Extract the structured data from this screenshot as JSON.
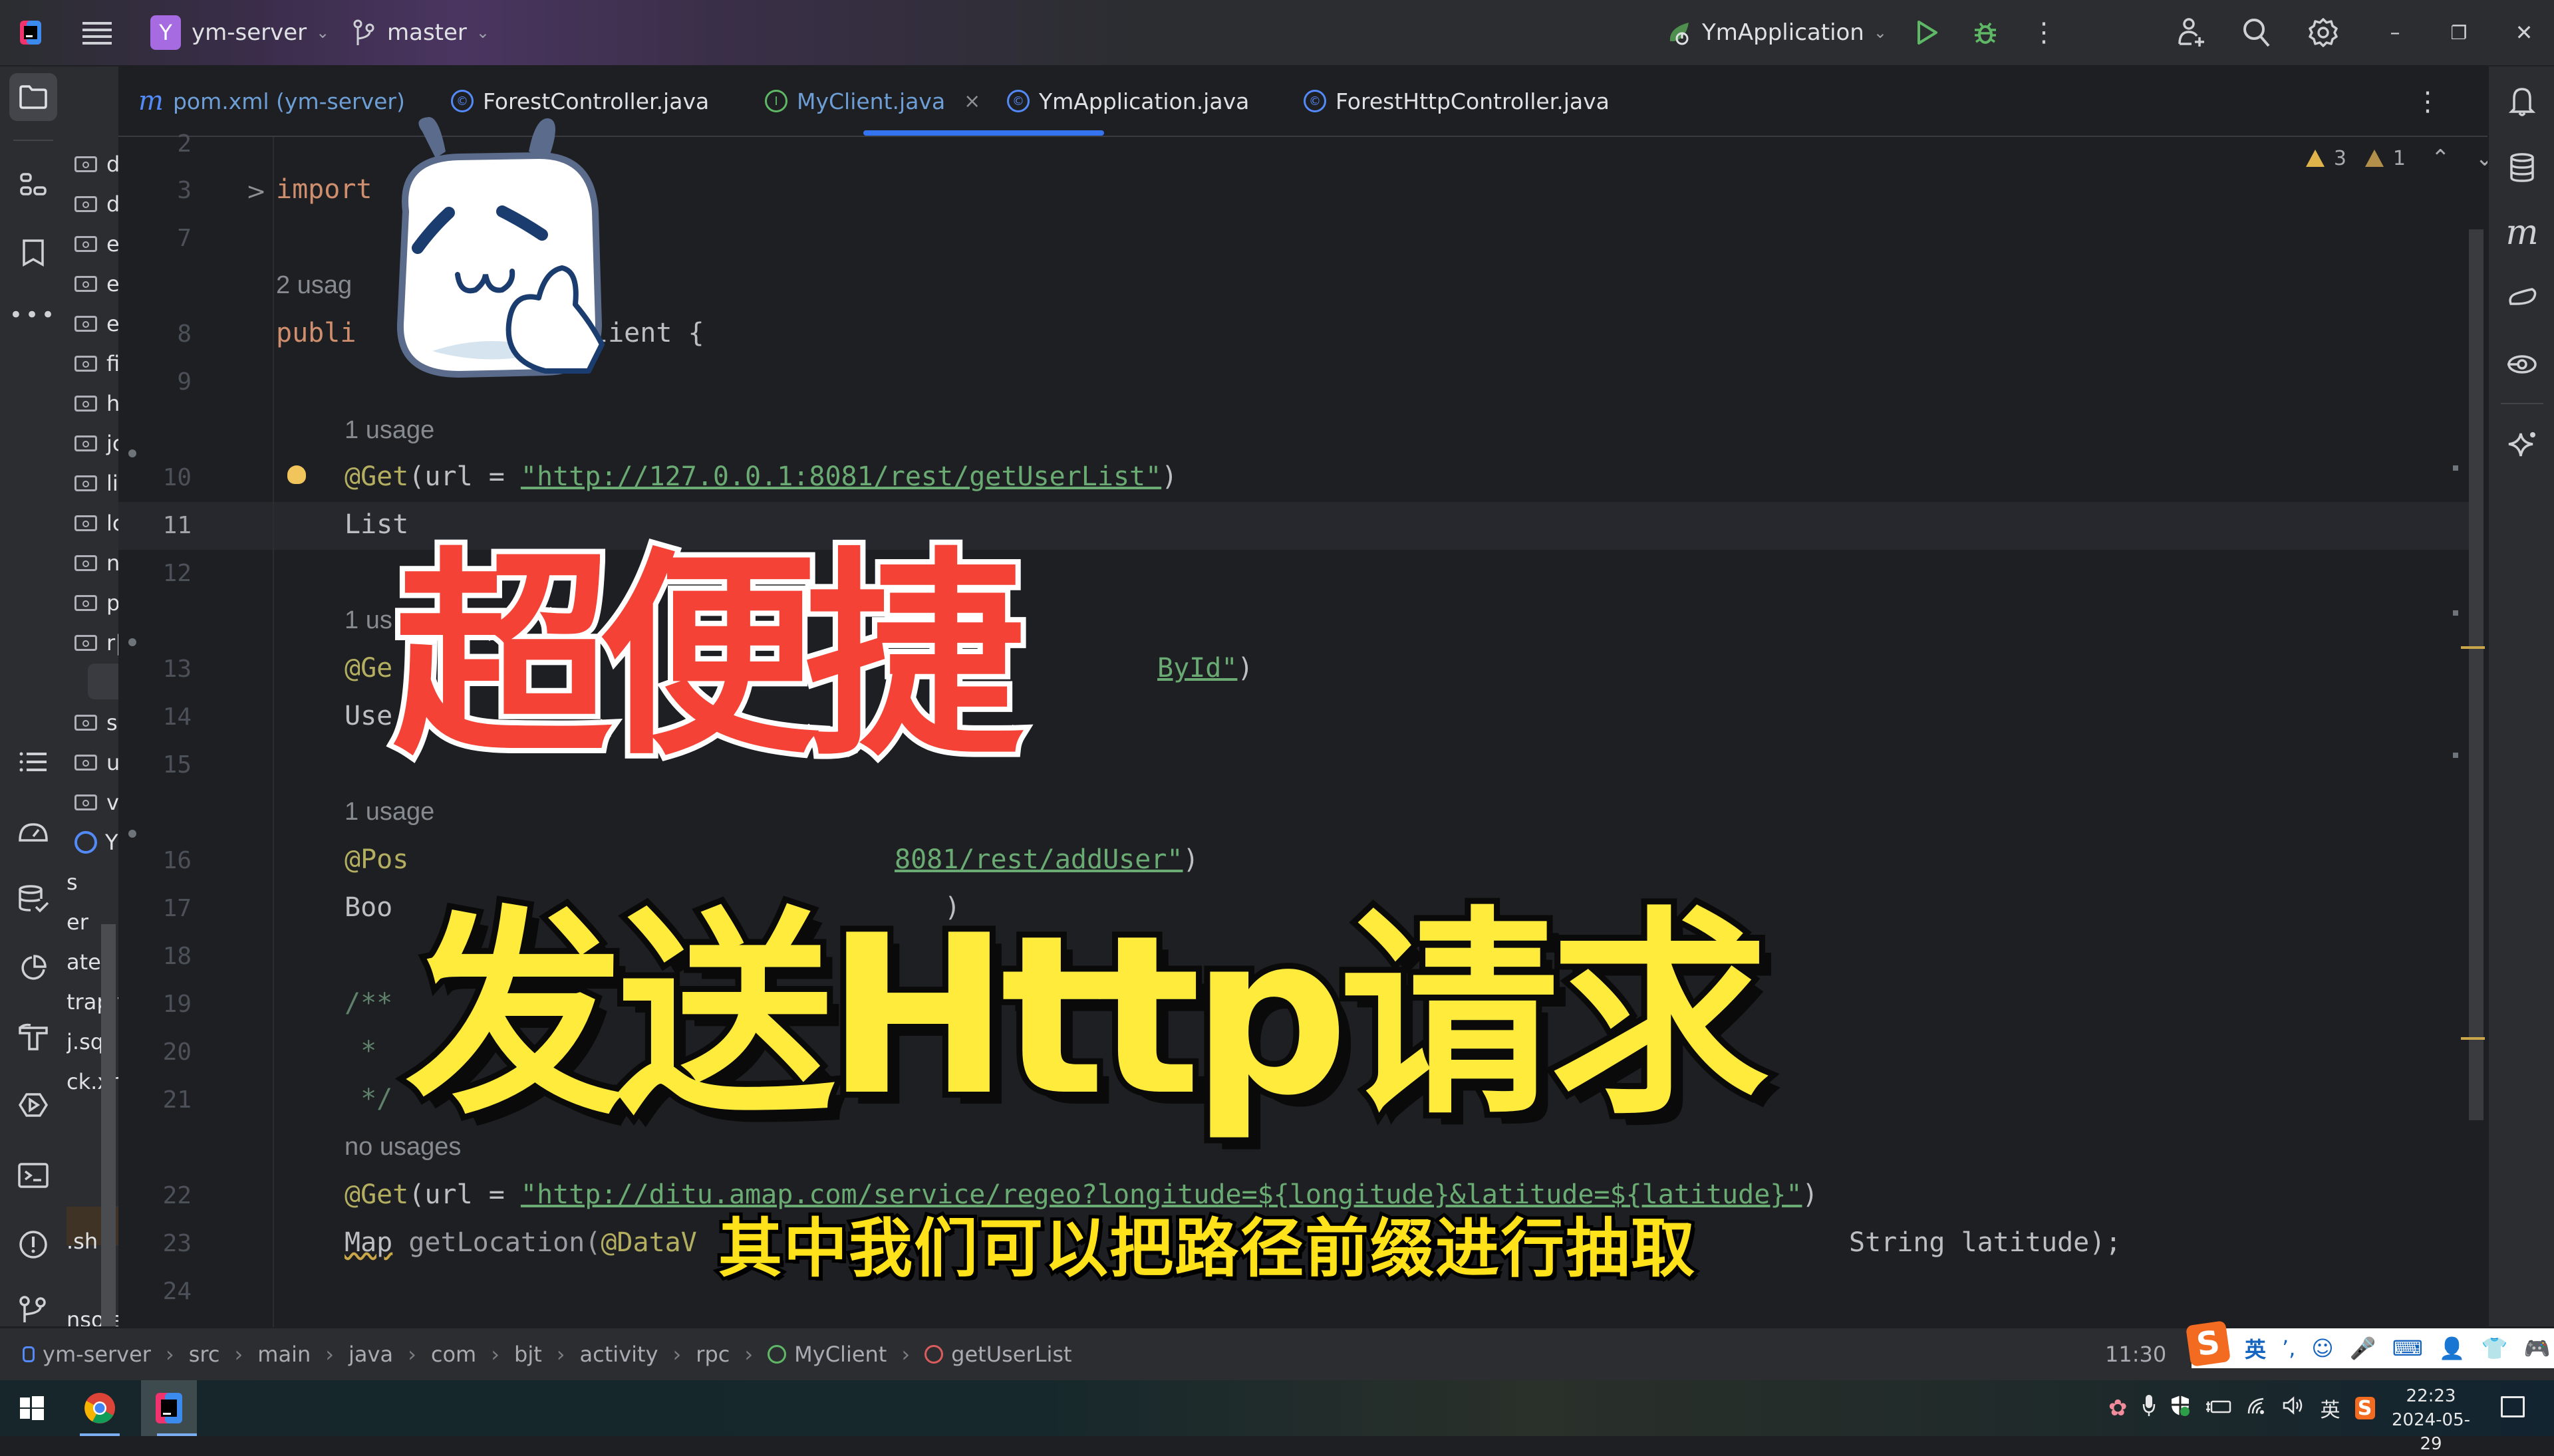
{
  "titlebar": {
    "project_badge": "Y",
    "project_name": "ym-server",
    "branch_name": "master",
    "run_config": "YmApplication",
    "icons": [
      "app-logo-icon",
      "main-menu-icon",
      "branch-icon",
      "run-config-icon",
      "run-icon",
      "debug-icon",
      "more-icon",
      "add-user-icon",
      "search-icon",
      "settings-icon",
      "minimize-icon",
      "restore-icon",
      "close-icon"
    ],
    "minimize": "–",
    "restore": "❐",
    "close": "✕"
  },
  "left_stripe": {
    "icons": [
      "project-icon",
      "structure-icon",
      "bookmarks-icon",
      "more-tools-icon",
      "todo-icon",
      "profiler-icon",
      "database-check-icon",
      "coverage-icon",
      "build-icon",
      "services-icon",
      "terminal-icon",
      "problems-icon",
      "git-icon"
    ]
  },
  "project_panel": {
    "folders": [
      "d",
      "d",
      "e",
      "e",
      "e",
      "fi",
      "h",
      "jc",
      "li",
      "lc",
      "n",
      "p",
      "r|",
      "s",
      "u",
      "v"
    ],
    "app_class": "Y",
    "files": [
      "s",
      "er",
      "ates",
      "trap.y",
      "j.sql",
      "ck.xn",
      ".sh",
      "nsoles"
    ]
  },
  "tabs": [
    {
      "label": "pom.xml (ym-server)",
      "icon": "maven-icon",
      "active": false
    },
    {
      "label": "ForestController.java",
      "icon": "class-icon",
      "active": false
    },
    {
      "label": "MyClient.java",
      "icon": "interface-icon",
      "active": true,
      "close": "×"
    },
    {
      "label": "YmApplication.java",
      "icon": "spring-class-icon",
      "active": false
    },
    {
      "label": "ForestHttpController.java",
      "icon": "class-icon",
      "active": false
    }
  ],
  "tab_more": "⋮",
  "inspections": {
    "warnings": "3",
    "weak_warnings": "1",
    "up": "⌃",
    "down": "⌄"
  },
  "editor": {
    "line_numbers": [
      "2",
      "3",
      "7",
      "8",
      "9",
      "10",
      "11",
      "12",
      "13",
      "14",
      "15",
      "16",
      "17",
      "18",
      "19",
      "20",
      "21",
      "22",
      "23",
      "24"
    ],
    "current_line": "11",
    "fold_marker": ">",
    "lines": {
      "l3": "import",
      "usage_class": "2 usag",
      "l8_a": "publi",
      "l8_b": "lient {",
      "usage1": "1 usage",
      "l10_ann": "@Get",
      "l10_a": "(url = ",
      "l10_str": "\"http://127.0.0.1:8081/rest/getUserList\"",
      "l10_b": ")",
      "l11": "List",
      "usage2": "1 us",
      "l13_ann": "@Ge",
      "l13_str": "ById\"",
      "l13_b": ")",
      "l14": "Use",
      "usage3": "1 usage",
      "l16_ann": "@Pos",
      "l16_str": "8081/rest/addUser\"",
      "l16_b": ")",
      "l17": "Boo",
      "l17_b": ")",
      "l19": "/**",
      "l20": " *",
      "l21": " */",
      "usage4": "no usages",
      "l22_ann": "@Get",
      "l22_a": "(url = ",
      "l22_str": "\"http://ditu.amap.com/service/regeo?longitude=${longitude}&latitude=${latitude}\"",
      "l22_b": ")",
      "l23_type": "Map",
      "l23_fn": " getLocation(",
      "l23_ann": "@DataV",
      "l23_tail": "String latitude);"
    }
  },
  "overlay": {
    "title_line1": "超便捷",
    "title_line2": "发送Http请求",
    "subtitle": "其中我们可以把路径前缀进行抽取",
    "title1_color": "#f44336",
    "title2_color": "#ffeb3b",
    "subtitle_color": "#ffe21a"
  },
  "breadcrumb": [
    "ym-server",
    "src",
    "main",
    "java",
    "com",
    "bjt",
    "activity",
    "rpc",
    "MyClient",
    "getUserList"
  ],
  "breadcrumb_sep": "›",
  "caret_position": "11:30",
  "ime": {
    "logo": "S",
    "mode": "英",
    "items": [
      "’,",
      "☺",
      "🎤",
      "⌨",
      "👤",
      "👕",
      "🎮",
      "▦",
      "⚙"
    ]
  },
  "right_stripe": {
    "icons": [
      "notifications-icon",
      "database-icon",
      "maven-icon",
      "gradle-icon",
      "endpoints-icon",
      "ai-assistant-icon"
    ]
  },
  "taskbar": {
    "apps": [
      "windows-start-icon",
      "chrome-icon",
      "intellij-icon"
    ],
    "tray": [
      "app-tray-icon",
      "microphone-icon",
      "security-icon",
      "battery-icon",
      "wifi-icon",
      "volume-icon"
    ],
    "ime_tray": "英",
    "time": "22:23",
    "date": "2024-05-29"
  }
}
